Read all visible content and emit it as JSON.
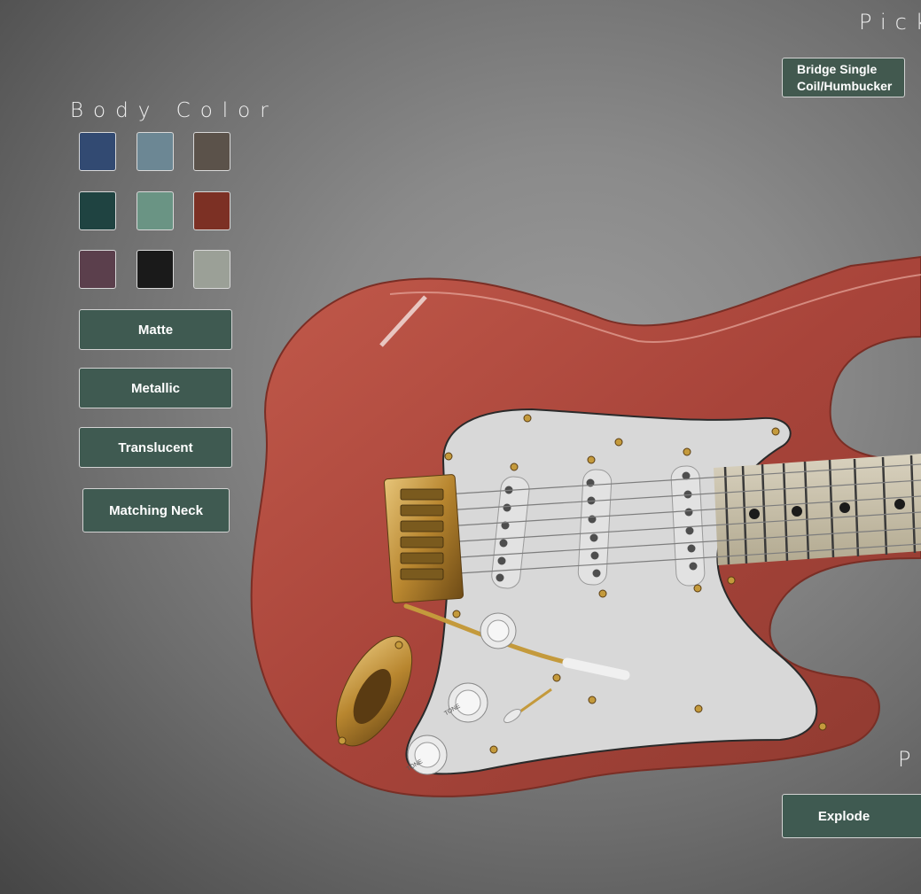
{
  "body_color": {
    "title": "Body Color",
    "swatches": [
      {
        "name": "blue",
        "color": "#324a72"
      },
      {
        "name": "slate",
        "color": "#6c8794"
      },
      {
        "name": "taupe",
        "color": "#5b524a"
      },
      {
        "name": "dark-teal",
        "color": "#1f4341"
      },
      {
        "name": "sage",
        "color": "#6a9484"
      },
      {
        "name": "red",
        "color": "#7c3024"
      },
      {
        "name": "plum",
        "color": "#5b3f4c"
      },
      {
        "name": "black",
        "color": "#1a1a1a"
      },
      {
        "name": "silver",
        "color": "#9ba097"
      }
    ],
    "finishes": {
      "matte": "Matte",
      "metallic": "Metallic",
      "translucent": "Translucent"
    },
    "matching_neck": "Matching Neck"
  },
  "pickups": {
    "title_partial": "Pick",
    "bridge_option_line1": "Bridge Single",
    "bridge_option_line2": "Coil/Humbucker"
  },
  "parts": {
    "title_partial": "P",
    "explode": "Explode"
  },
  "guitar": {
    "body_color": "#b0483a",
    "pickguard_color": "#d9d9d9",
    "hardware_color": "#c49a3c",
    "knob_label": "TONE"
  }
}
